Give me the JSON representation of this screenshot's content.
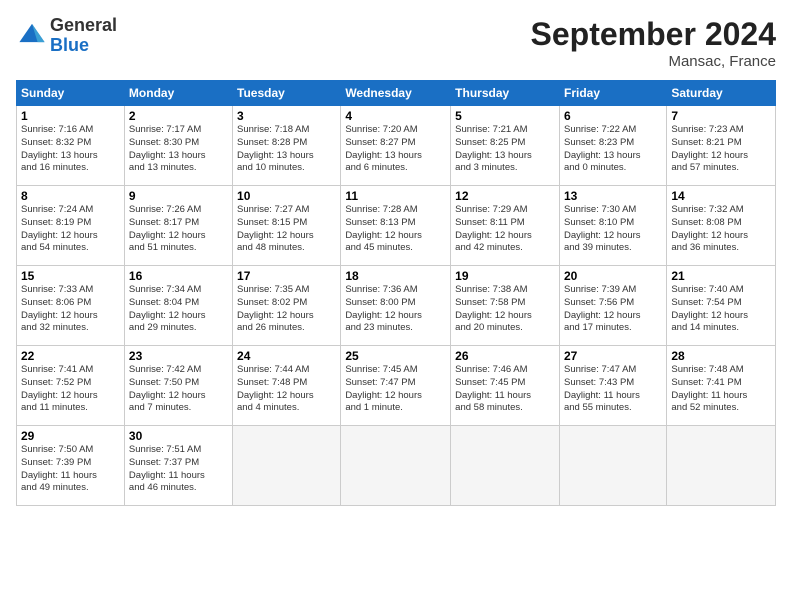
{
  "header": {
    "logo_general": "General",
    "logo_blue": "Blue",
    "month_title": "September 2024",
    "location": "Mansac, France"
  },
  "weekdays": [
    "Sunday",
    "Monday",
    "Tuesday",
    "Wednesday",
    "Thursday",
    "Friday",
    "Saturday"
  ],
  "weeks": [
    [
      {
        "day": "1",
        "info": "Sunrise: 7:16 AM\nSunset: 8:32 PM\nDaylight: 13 hours\nand 16 minutes."
      },
      {
        "day": "2",
        "info": "Sunrise: 7:17 AM\nSunset: 8:30 PM\nDaylight: 13 hours\nand 13 minutes."
      },
      {
        "day": "3",
        "info": "Sunrise: 7:18 AM\nSunset: 8:28 PM\nDaylight: 13 hours\nand 10 minutes."
      },
      {
        "day": "4",
        "info": "Sunrise: 7:20 AM\nSunset: 8:27 PM\nDaylight: 13 hours\nand 6 minutes."
      },
      {
        "day": "5",
        "info": "Sunrise: 7:21 AM\nSunset: 8:25 PM\nDaylight: 13 hours\nand 3 minutes."
      },
      {
        "day": "6",
        "info": "Sunrise: 7:22 AM\nSunset: 8:23 PM\nDaylight: 13 hours\nand 0 minutes."
      },
      {
        "day": "7",
        "info": "Sunrise: 7:23 AM\nSunset: 8:21 PM\nDaylight: 12 hours\nand 57 minutes."
      }
    ],
    [
      {
        "day": "8",
        "info": "Sunrise: 7:24 AM\nSunset: 8:19 PM\nDaylight: 12 hours\nand 54 minutes."
      },
      {
        "day": "9",
        "info": "Sunrise: 7:26 AM\nSunset: 8:17 PM\nDaylight: 12 hours\nand 51 minutes."
      },
      {
        "day": "10",
        "info": "Sunrise: 7:27 AM\nSunset: 8:15 PM\nDaylight: 12 hours\nand 48 minutes."
      },
      {
        "day": "11",
        "info": "Sunrise: 7:28 AM\nSunset: 8:13 PM\nDaylight: 12 hours\nand 45 minutes."
      },
      {
        "day": "12",
        "info": "Sunrise: 7:29 AM\nSunset: 8:11 PM\nDaylight: 12 hours\nand 42 minutes."
      },
      {
        "day": "13",
        "info": "Sunrise: 7:30 AM\nSunset: 8:10 PM\nDaylight: 12 hours\nand 39 minutes."
      },
      {
        "day": "14",
        "info": "Sunrise: 7:32 AM\nSunset: 8:08 PM\nDaylight: 12 hours\nand 36 minutes."
      }
    ],
    [
      {
        "day": "15",
        "info": "Sunrise: 7:33 AM\nSunset: 8:06 PM\nDaylight: 12 hours\nand 32 minutes."
      },
      {
        "day": "16",
        "info": "Sunrise: 7:34 AM\nSunset: 8:04 PM\nDaylight: 12 hours\nand 29 minutes."
      },
      {
        "day": "17",
        "info": "Sunrise: 7:35 AM\nSunset: 8:02 PM\nDaylight: 12 hours\nand 26 minutes."
      },
      {
        "day": "18",
        "info": "Sunrise: 7:36 AM\nSunset: 8:00 PM\nDaylight: 12 hours\nand 23 minutes."
      },
      {
        "day": "19",
        "info": "Sunrise: 7:38 AM\nSunset: 7:58 PM\nDaylight: 12 hours\nand 20 minutes."
      },
      {
        "day": "20",
        "info": "Sunrise: 7:39 AM\nSunset: 7:56 PM\nDaylight: 12 hours\nand 17 minutes."
      },
      {
        "day": "21",
        "info": "Sunrise: 7:40 AM\nSunset: 7:54 PM\nDaylight: 12 hours\nand 14 minutes."
      }
    ],
    [
      {
        "day": "22",
        "info": "Sunrise: 7:41 AM\nSunset: 7:52 PM\nDaylight: 12 hours\nand 11 minutes."
      },
      {
        "day": "23",
        "info": "Sunrise: 7:42 AM\nSunset: 7:50 PM\nDaylight: 12 hours\nand 7 minutes."
      },
      {
        "day": "24",
        "info": "Sunrise: 7:44 AM\nSunset: 7:48 PM\nDaylight: 12 hours\nand 4 minutes."
      },
      {
        "day": "25",
        "info": "Sunrise: 7:45 AM\nSunset: 7:47 PM\nDaylight: 12 hours\nand 1 minute."
      },
      {
        "day": "26",
        "info": "Sunrise: 7:46 AM\nSunset: 7:45 PM\nDaylight: 11 hours\nand 58 minutes."
      },
      {
        "day": "27",
        "info": "Sunrise: 7:47 AM\nSunset: 7:43 PM\nDaylight: 11 hours\nand 55 minutes."
      },
      {
        "day": "28",
        "info": "Sunrise: 7:48 AM\nSunset: 7:41 PM\nDaylight: 11 hours\nand 52 minutes."
      }
    ],
    [
      {
        "day": "29",
        "info": "Sunrise: 7:50 AM\nSunset: 7:39 PM\nDaylight: 11 hours\nand 49 minutes."
      },
      {
        "day": "30",
        "info": "Sunrise: 7:51 AM\nSunset: 7:37 PM\nDaylight: 11 hours\nand 46 minutes."
      },
      {
        "day": "",
        "info": ""
      },
      {
        "day": "",
        "info": ""
      },
      {
        "day": "",
        "info": ""
      },
      {
        "day": "",
        "info": ""
      },
      {
        "day": "",
        "info": ""
      }
    ]
  ]
}
